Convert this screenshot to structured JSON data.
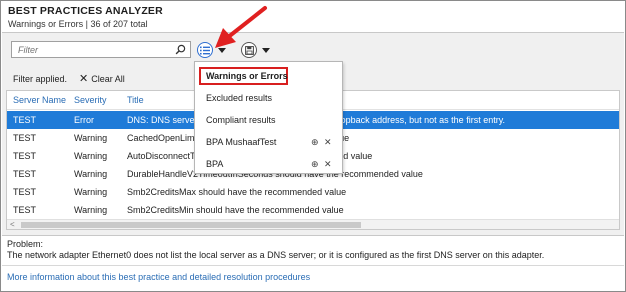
{
  "header": {
    "title": "BEST PRACTICES ANALYZER",
    "subtitle": "Warnings or Errors | 36 of 207 total"
  },
  "toolbar": {
    "filter_placeholder": "Filter",
    "filter_applied": "Filter applied.",
    "clear_all": "Clear All"
  },
  "grid": {
    "columns": [
      "Server Name",
      "Severity",
      "Title"
    ],
    "rows": [
      {
        "server": "TEST",
        "severity": "Error",
        "title": "DNS: DNS servers on Ethernet0 should include the loopback address, but not as the first entry.",
        "selected": true
      },
      {
        "server": "TEST",
        "severity": "Warning",
        "title": "CachedOpenLimit should have the recommended value"
      },
      {
        "server": "TEST",
        "severity": "Warning",
        "title": "AutoDisconnectTimeout should have the recommended value"
      },
      {
        "server": "TEST",
        "severity": "Warning",
        "title": "DurableHandleV2TimeoutInSeconds should have the recommended value"
      },
      {
        "server": "TEST",
        "severity": "Warning",
        "title": "Smb2CreditsMax should have the recommended value"
      },
      {
        "server": "TEST",
        "severity": "Warning",
        "title": "Smb2CreditsMin should have the recommended value"
      }
    ]
  },
  "problem": {
    "label": "Problem:",
    "text": "The network adapter Ethernet0 does not list the local server as a DNS server; or it is configured as the first DNS server on this adapter."
  },
  "more_link": "More information about this best practice and detailed resolution procedures",
  "dropdown": {
    "items": [
      {
        "label": "Warnings or Errors",
        "current": true
      },
      {
        "label": "Excluded results"
      },
      {
        "label": "Compliant results"
      },
      {
        "label": "BPA MushaafTest",
        "custom": true
      },
      {
        "label": "BPA",
        "custom": true
      }
    ]
  },
  "colors": {
    "accent": "#1f7bd8",
    "link": "#2a6db5",
    "highlight_box": "#d81f1f",
    "annotation_arrow": "#e02020"
  },
  "icons": [
    "search-icon",
    "filter-list-icon",
    "save-query-icon",
    "chevron-down-icon",
    "pin-icon",
    "close-icon"
  ]
}
